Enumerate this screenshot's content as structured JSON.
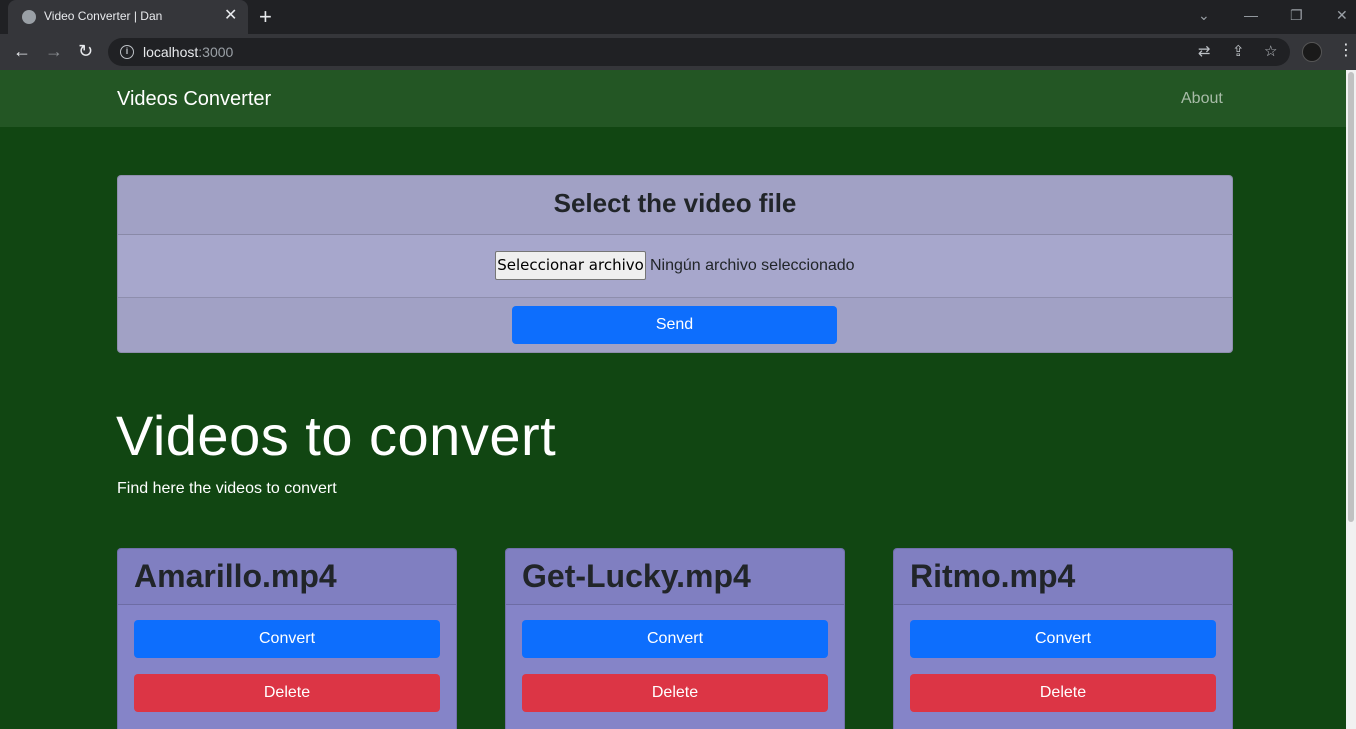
{
  "browser": {
    "tab_title": "Video Converter | Dan",
    "new_tab": "+",
    "close_tab": "✕",
    "url_host": "localhost",
    "url_port": ":3000"
  },
  "navbar": {
    "brand": "Videos Converter",
    "about": "About"
  },
  "upload": {
    "title": "Select the video file",
    "file_button": "Seleccionar archivo",
    "file_status": "Ningún archivo seleccionado",
    "send": "Send"
  },
  "videos_section": {
    "title": "Videos to convert",
    "subtitle": "Find here the videos to convert"
  },
  "videos": [
    {
      "name": "Amarillo.mp4",
      "convert": "Convert",
      "delete": "Delete"
    },
    {
      "name": "Get-Lucky.mp4",
      "convert": "Convert",
      "delete": "Delete"
    },
    {
      "name": "Ritmo.mp4",
      "convert": "Convert",
      "delete": "Delete"
    }
  ],
  "colors": {
    "page_bg": "#114612",
    "navbar_bg": "#235624",
    "upload_card_bg": "#a7a7cc",
    "video_card_bg": "#8584c8",
    "primary": "#0d6efd",
    "danger": "#dc3545"
  }
}
